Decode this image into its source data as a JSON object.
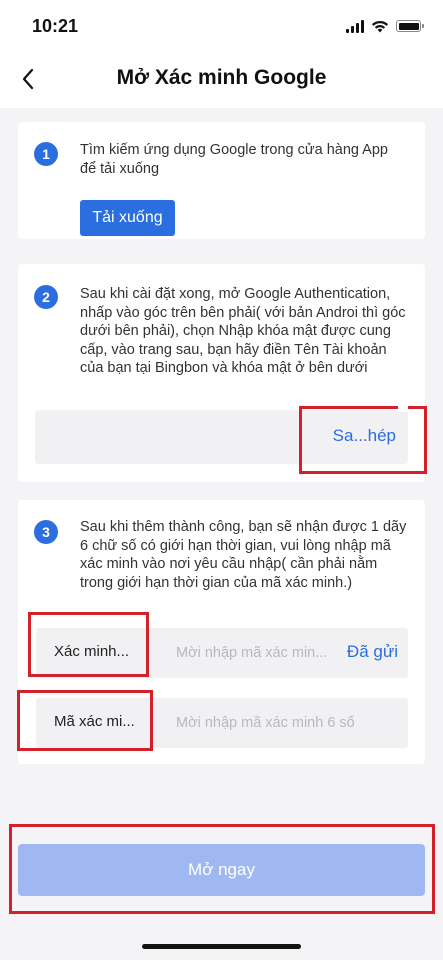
{
  "status_bar": {
    "time": "10:21"
  },
  "header": {
    "title": "Mở Xác minh Google"
  },
  "steps": [
    {
      "number": "1",
      "text": "Tìm kiếm ứng dụng Google trong cửa hàng App để tải xuống",
      "button": "Tải xuống"
    },
    {
      "number": "2",
      "text": "Sau khi cài đặt xong, mở Google Authentication, nhấp vào góc trên bên phải( với bản Androi thì góc dưới bên phải), chọn Nhập khóa mật được cung cấp, vào trang sau, bạn hãy điền Tên Tài khoản của bạn tại Bingbon và khóa mật ở bên dưới",
      "copy_label": "Sa...hép"
    },
    {
      "number": "3",
      "text": "Sau khi thêm thành công, bạn sẽ nhận được 1 dãy 6 chữ số có giới hạn thời gian, vui lòng nhập mã xác minh vào nơi yêu cầu nhập( cần phải nằm trong giới hạn thời gian của mã xác minh.)"
    }
  ],
  "inputs": {
    "email_code": {
      "label": "Xác minh...",
      "placeholder": "Mời nhập mã xác min...",
      "send_label": "Đã gửi"
    },
    "google_code": {
      "label": "Mã xác mi...",
      "placeholder": "Mời nhập mã xác minh 6 số"
    }
  },
  "footer": {
    "submit_label": "Mở ngay"
  },
  "colors": {
    "accent": "#2a6ee0",
    "disabled_button": "#9fb8f1",
    "highlight": "#d4202a",
    "background": "#f4f4f6"
  }
}
